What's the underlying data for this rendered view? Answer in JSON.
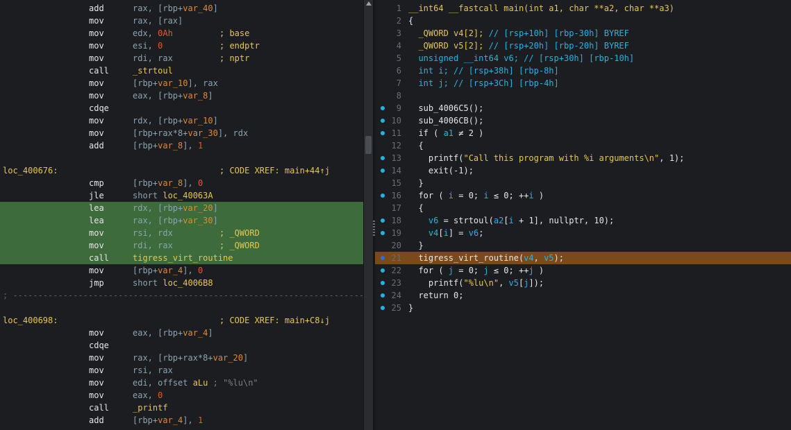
{
  "asm": {
    "rows": [
      {
        "kind": "ins",
        "mn": "add",
        "op": [
          [
            "rax, [rbp+",
            ""
          ],
          [
            "var_40",
            "var"
          ],
          [
            "]",
            ""
          ]
        ],
        "cm": ""
      },
      {
        "kind": "ins",
        "mn": "mov",
        "op": [
          [
            "rax, [rax]",
            ""
          ]
        ],
        "cm": ""
      },
      {
        "kind": "ins",
        "mn": "mov",
        "op": [
          [
            "edx, ",
            ""
          ],
          [
            "0Ah",
            "num"
          ]
        ],
        "cm": "; base"
      },
      {
        "kind": "ins",
        "mn": "mov",
        "op": [
          [
            "esi, ",
            ""
          ],
          [
            "0",
            "num"
          ]
        ],
        "cm": "; endptr"
      },
      {
        "kind": "ins",
        "mn": "mov",
        "op": [
          [
            "rdi, rax",
            ""
          ]
        ],
        "cm": "; nptr"
      },
      {
        "kind": "ins",
        "mn": "call",
        "op": [
          [
            "_strtoul",
            "fn"
          ]
        ],
        "cm": ""
      },
      {
        "kind": "ins",
        "mn": "mov",
        "op": [
          [
            "[rbp+",
            ""
          ],
          [
            "var_10",
            "var"
          ],
          [
            "], rax",
            ""
          ]
        ],
        "cm": ""
      },
      {
        "kind": "ins",
        "mn": "mov",
        "op": [
          [
            "eax, [rbp+",
            ""
          ],
          [
            "var_8",
            "var"
          ],
          [
            "]",
            ""
          ]
        ],
        "cm": ""
      },
      {
        "kind": "ins",
        "mn": "cdqe",
        "op": [],
        "cm": ""
      },
      {
        "kind": "ins",
        "mn": "mov",
        "op": [
          [
            "rdx, [rbp+",
            ""
          ],
          [
            "var_10",
            "var"
          ],
          [
            "]",
            ""
          ]
        ],
        "cm": ""
      },
      {
        "kind": "ins",
        "mn": "mov",
        "op": [
          [
            "[rbp+rax*8+",
            ""
          ],
          [
            "var_30",
            "var"
          ],
          [
            "], rdx",
            ""
          ]
        ],
        "cm": ""
      },
      {
        "kind": "ins",
        "mn": "add",
        "op": [
          [
            "[rbp+",
            ""
          ],
          [
            "var_8",
            "var"
          ],
          [
            "], ",
            ""
          ],
          [
            "1",
            "num"
          ]
        ],
        "cm": ""
      },
      {
        "kind": "blank"
      },
      {
        "kind": "label",
        "lbl": "loc_400676:",
        "cm": "; CODE XREF: main+44↑j"
      },
      {
        "kind": "ins",
        "mn": "cmp",
        "op": [
          [
            "[rbp+",
            ""
          ],
          [
            "var_8",
            "var"
          ],
          [
            "], ",
            ""
          ],
          [
            "0",
            "num"
          ]
        ],
        "cm": ""
      },
      {
        "kind": "ins",
        "mn": "jle",
        "op": [
          [
            "short ",
            ""
          ],
          [
            "loc_40063A",
            "fn"
          ]
        ],
        "cm": ""
      },
      {
        "kind": "ins",
        "hl": true,
        "mn": "lea",
        "op": [
          [
            "rdx, [rbp+",
            ""
          ],
          [
            "var_20",
            "var"
          ],
          [
            "]",
            ""
          ]
        ],
        "cm": ""
      },
      {
        "kind": "ins",
        "hl": true,
        "mn": "lea",
        "op": [
          [
            "rax, [rbp+",
            ""
          ],
          [
            "var_30",
            "var"
          ],
          [
            "]",
            ""
          ]
        ],
        "cm": ""
      },
      {
        "kind": "ins",
        "hl": true,
        "mn": "mov",
        "op": [
          [
            "rsi, rdx",
            ""
          ]
        ],
        "cm": "; _QWORD"
      },
      {
        "kind": "ins",
        "hl": true,
        "mn": "mov",
        "op": [
          [
            "rdi, rax",
            ""
          ]
        ],
        "cm": "; _QWORD"
      },
      {
        "kind": "ins",
        "hl": true,
        "mn": "call",
        "op": [
          [
            "tigress_virt_routine",
            "fn"
          ]
        ],
        "cm": ""
      },
      {
        "kind": "ins",
        "mn": "mov",
        "op": [
          [
            "[rbp+",
            ""
          ],
          [
            "var_4",
            "var"
          ],
          [
            "], ",
            ""
          ],
          [
            "0",
            "num"
          ]
        ],
        "cm": ""
      },
      {
        "kind": "ins",
        "mn": "jmp",
        "op": [
          [
            "short ",
            ""
          ],
          [
            "loc_4006B8",
            "fn"
          ]
        ],
        "cm": ""
      },
      {
        "kind": "sep",
        "text": "; ---------------------------------------------------------------------------"
      },
      {
        "kind": "blank"
      },
      {
        "kind": "label",
        "lbl": "loc_400698:",
        "cm": "; CODE XREF: main+C8↓j"
      },
      {
        "kind": "ins",
        "mn": "mov",
        "op": [
          [
            "eax, [rbp+",
            ""
          ],
          [
            "var_4",
            "var"
          ],
          [
            "]",
            ""
          ]
        ],
        "cm": ""
      },
      {
        "kind": "ins",
        "mn": "cdqe",
        "op": [],
        "cm": ""
      },
      {
        "kind": "ins",
        "mn": "mov",
        "op": [
          [
            "rax, [rbp+rax*8+",
            ""
          ],
          [
            "var_20",
            "var"
          ],
          [
            "]",
            ""
          ]
        ],
        "cm": ""
      },
      {
        "kind": "ins",
        "mn": "mov",
        "op": [
          [
            "rsi, rax",
            ""
          ]
        ],
        "cm": ""
      },
      {
        "kind": "ins",
        "mn": "mov",
        "op": [
          [
            "edi, offset ",
            ""
          ],
          [
            "aLu",
            "fn"
          ],
          [
            " ; \"%lu\\n\"",
            "gray"
          ]
        ],
        "cm": ""
      },
      {
        "kind": "ins",
        "mn": "mov",
        "op": [
          [
            "eax, ",
            ""
          ],
          [
            "0",
            "num"
          ]
        ],
        "cm": ""
      },
      {
        "kind": "ins",
        "mn": "call",
        "op": [
          [
            "_printf",
            "fn"
          ]
        ],
        "cm": ""
      },
      {
        "kind": "ins",
        "mn": "add",
        "op": [
          [
            "[rbp+",
            ""
          ],
          [
            "var_4",
            "var"
          ],
          [
            "], ",
            ""
          ],
          [
            "1",
            "num"
          ]
        ],
        "cm": ""
      }
    ]
  },
  "code": {
    "rows": [
      {
        "n": "1",
        "dot": "",
        "hl": false,
        "t": [
          [
            "__int64 __fastcall main(int a1, char **a2, char **a3)",
            "c-ty"
          ]
        ]
      },
      {
        "n": "2",
        "dot": "",
        "hl": false,
        "t": [
          [
            "{",
            ""
          ]
        ]
      },
      {
        "n": "3",
        "dot": "",
        "hl": false,
        "t": [
          [
            "  _QWORD v4[2]; ",
            "c-ty"
          ],
          [
            "// [rsp+10h] [rbp-30h] BYREF",
            "c-cm"
          ]
        ]
      },
      {
        "n": "4",
        "dot": "",
        "hl": false,
        "t": [
          [
            "  _QWORD v5[2]; ",
            "c-ty"
          ],
          [
            "// [rsp+20h] [rbp-20h] BYREF",
            "c-cm"
          ]
        ]
      },
      {
        "n": "5",
        "dot": "",
        "hl": false,
        "t": [
          [
            "  unsigned __int64 v6; ",
            "c-var"
          ],
          [
            "// [rsp+30h] [rbp-10h]",
            "c-cm"
          ]
        ]
      },
      {
        "n": "6",
        "dot": "",
        "hl": false,
        "t": [
          [
            "  int i; ",
            "c-var"
          ],
          [
            "// [rsp+38h] [rbp-8h]",
            "c-cm"
          ]
        ]
      },
      {
        "n": "7",
        "dot": "",
        "hl": false,
        "t": [
          [
            "  int j; ",
            "c-var"
          ],
          [
            "// [rsp+3Ch] [rbp-4h]",
            "c-cm"
          ]
        ]
      },
      {
        "n": "8",
        "dot": "",
        "hl": false,
        "t": [
          [
            "",
            ""
          ]
        ]
      },
      {
        "n": "9",
        "dot": "b",
        "hl": false,
        "t": [
          [
            "  sub_4006C5();",
            ""
          ]
        ]
      },
      {
        "n": "10",
        "dot": "b",
        "hl": false,
        "t": [
          [
            "  sub_4006CB();",
            ""
          ]
        ]
      },
      {
        "n": "11",
        "dot": "b",
        "hl": false,
        "t": [
          [
            "  if ( ",
            ""
          ],
          [
            "a1",
            "c-var"
          ],
          [
            " ≠ 2 )",
            ""
          ]
        ]
      },
      {
        "n": "12",
        "dot": "",
        "hl": false,
        "t": [
          [
            "  {",
            ""
          ]
        ]
      },
      {
        "n": "13",
        "dot": "b",
        "hl": false,
        "t": [
          [
            "    printf(",
            ""
          ],
          [
            "\"Call this program with %i arguments\\n\"",
            "c-str"
          ],
          [
            ", 1);",
            ""
          ]
        ]
      },
      {
        "n": "14",
        "dot": "b",
        "hl": false,
        "t": [
          [
            "    exit(-1);",
            ""
          ]
        ]
      },
      {
        "n": "15",
        "dot": "",
        "hl": false,
        "t": [
          [
            "  }",
            ""
          ]
        ]
      },
      {
        "n": "16",
        "dot": "b",
        "hl": false,
        "t": [
          [
            "  for ( ",
            ""
          ],
          [
            "i",
            "c-var"
          ],
          [
            " = 0; ",
            ""
          ],
          [
            "i",
            "c-var"
          ],
          [
            " ≤ 0; ++",
            ""
          ],
          [
            "i",
            "c-var"
          ],
          [
            " )",
            ""
          ]
        ]
      },
      {
        "n": "17",
        "dot": "",
        "hl": false,
        "t": [
          [
            "  {",
            ""
          ]
        ]
      },
      {
        "n": "18",
        "dot": "b",
        "hl": false,
        "t": [
          [
            "    ",
            ""
          ],
          [
            "v6",
            "c-var"
          ],
          [
            " = strtoul(",
            ""
          ],
          [
            "a2",
            "c-var"
          ],
          [
            "[",
            ""
          ],
          [
            "i",
            "c-var"
          ],
          [
            " + 1], nullptr, 10);",
            ""
          ]
        ]
      },
      {
        "n": "19",
        "dot": "b",
        "hl": false,
        "t": [
          [
            "    ",
            ""
          ],
          [
            "v4",
            "c-var"
          ],
          [
            "[",
            ""
          ],
          [
            "i",
            "c-var"
          ],
          [
            "] = ",
            ""
          ],
          [
            "v6",
            "c-var"
          ],
          [
            ";",
            ""
          ]
        ]
      },
      {
        "n": "20",
        "dot": "",
        "hl": false,
        "t": [
          [
            "  }",
            ""
          ]
        ]
      },
      {
        "n": "21",
        "dot": "d",
        "hl": true,
        "t": [
          [
            "  tigress_virt_routine(",
            ""
          ],
          [
            "v4",
            "c-var"
          ],
          [
            ", ",
            ""
          ],
          [
            "v5",
            "c-var"
          ],
          [
            ");",
            ""
          ]
        ]
      },
      {
        "n": "22",
        "dot": "b",
        "hl": false,
        "t": [
          [
            "  for ( ",
            ""
          ],
          [
            "j",
            "c-var"
          ],
          [
            " = 0; ",
            ""
          ],
          [
            "j",
            "c-var"
          ],
          [
            " ≤ 0; ++",
            ""
          ],
          [
            "j",
            "c-var"
          ],
          [
            " )",
            ""
          ]
        ]
      },
      {
        "n": "23",
        "dot": "b",
        "hl": false,
        "t": [
          [
            "    printf(",
            ""
          ],
          [
            "\"%lu\\n\"",
            "c-str"
          ],
          [
            ", ",
            ""
          ],
          [
            "v5",
            "c-var"
          ],
          [
            "[",
            ""
          ],
          [
            "j",
            "c-var"
          ],
          [
            "]);",
            ""
          ]
        ]
      },
      {
        "n": "24",
        "dot": "b",
        "hl": false,
        "t": [
          [
            "  return 0;",
            ""
          ]
        ]
      },
      {
        "n": "25",
        "dot": "b",
        "hl": false,
        "t": [
          [
            "}",
            ""
          ]
        ]
      }
    ]
  }
}
